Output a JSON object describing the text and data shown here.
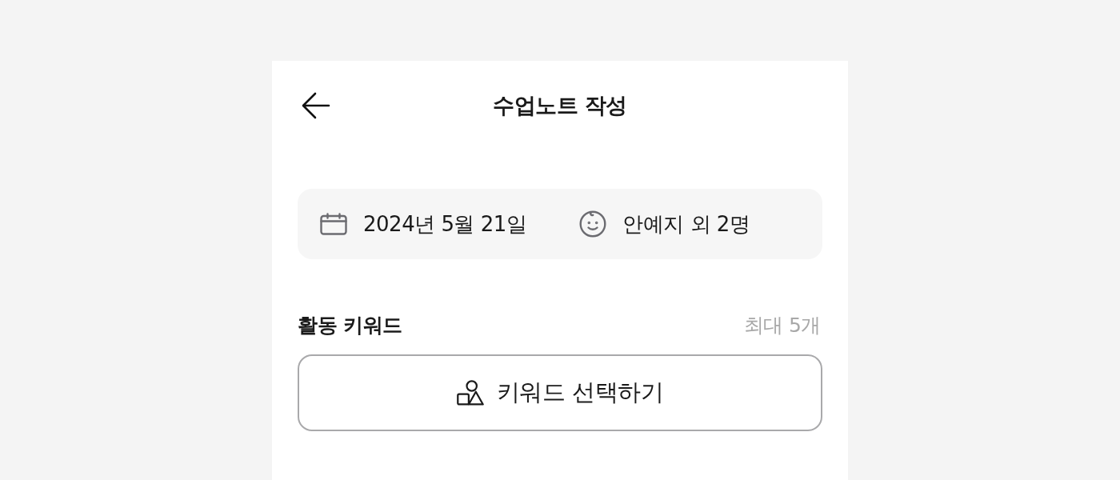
{
  "header": {
    "title": "수업노트 작성"
  },
  "info": {
    "date": "2024년 5월 21일",
    "students": "안예지 외 2명"
  },
  "keyword_section": {
    "title": "활동 키워드",
    "limit": "최대 5개",
    "button": "키워드 선택하기"
  }
}
